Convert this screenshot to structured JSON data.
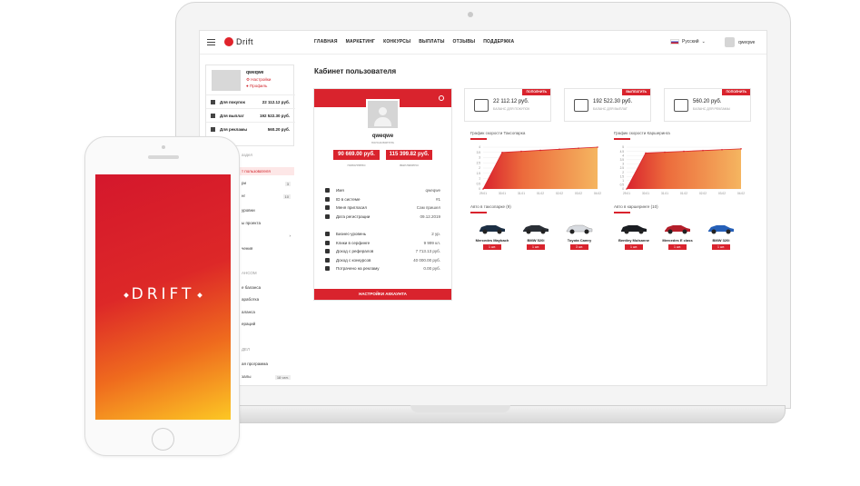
{
  "topbar": {
    "logo": "Drift",
    "nav": [
      "ГЛАВНАЯ",
      "МАРКЕТИНГ",
      "КОНКУРСЫ",
      "ВЫПЛАТЫ",
      "ОТЗЫВЫ",
      "ПОДДЕРЖКА"
    ],
    "language": "Русский",
    "username": "qweqwe"
  },
  "sidebar": {
    "name": "qweqwe",
    "link_settings": "Настройки",
    "link_profile": "Профиль",
    "rows": [
      {
        "label": "Для покупок",
        "value": "22 112.12 руб."
      },
      {
        "label": "Для выплат",
        "value": "192 522.30 руб."
      },
      {
        "label": "Для рекламы",
        "value": "560.20 руб."
      }
    ],
    "menu": [
      {
        "text": "аздел",
        "type": "head"
      },
      {
        "text": "т пользователя",
        "type": "active"
      },
      {
        "text": "ри",
        "count": "3"
      },
      {
        "text": "нг",
        "count": "10"
      },
      {
        "text": "уровни"
      },
      {
        "text": "ы проекта"
      },
      {
        "text": ""
      },
      {
        "text": "чения"
      },
      {
        "text": "АНСОМ",
        "type": "head"
      },
      {
        "text": "е баланса"
      },
      {
        "text": "аработка"
      },
      {
        "text": "аланса"
      },
      {
        "text": "ераций"
      },
      {
        "text": "ДЕЛ",
        "type": "head"
      },
      {
        "text": "ая программа"
      },
      {
        "text": "залы",
        "count": "18 чел."
      }
    ]
  },
  "main": {
    "page_title": "Кабинет пользователя",
    "profile": {
      "name": "qweqwe",
      "role": "пользователь",
      "deposit": "90 669.00 руб.",
      "deposit_label": "пополнено",
      "withdrawn": "115 399.82 руб.",
      "withdrawn_label": "выплачено",
      "info": [
        {
          "k": "Имя",
          "v": "qweqwe"
        },
        {
          "k": "ID в системе",
          "v": "#1"
        },
        {
          "k": "Меня пригласил",
          "v": "Сам пришел"
        },
        {
          "k": "Дата регистрации",
          "v": "09.12.2019"
        }
      ],
      "stats": [
        {
          "k": "Бизнес-уровень",
          "v": "2 ур."
        },
        {
          "k": "Клики в серфинге",
          "v": "9 999 кл."
        },
        {
          "k": "Доход с рефералов",
          "v": "7 713.13 руб."
        },
        {
          "k": "Доход с конкурсов",
          "v": "40 000.00 руб."
        },
        {
          "k": "Потрачено на рекламу",
          "v": "0.00 руб."
        }
      ],
      "settings_button": "НАСТРОЙКИ АККАУНТА"
    },
    "balances": [
      {
        "amount": "22 112.12 руб.",
        "sub": "БАЛАНС ДЛЯ ПОКУПОК",
        "button": "ПОПОЛНИТЬ"
      },
      {
        "amount": "192 522.30 руб.",
        "sub": "БАЛАНС ДЛЯ ВЫПЛАТ",
        "button": "ВЫПЛАТИТЬ"
      },
      {
        "amount": "560.20 руб.",
        "sub": "БАЛАНС ДЛЯ РЕКЛАМЫ",
        "button": "ПОПОЛНИТЬ"
      }
    ],
    "cars_taxi_title": "Авто в таксопарке (9)",
    "cars_taxi": [
      {
        "name": "Mercedes Maybach",
        "count": "1 шт."
      },
      {
        "name": "BMW 520i",
        "count": "1 шт."
      },
      {
        "name": "Toyota Camry",
        "count": "3 шт."
      }
    ],
    "cars_share_title": "Авто в каршеринге (10)",
    "cars_share": [
      {
        "name": "Bentley Mulsanne",
        "count": "1 шт."
      },
      {
        "name": "Mercedes E class",
        "count": "1 шт."
      },
      {
        "name": "BMW 320i",
        "count": "1 шт."
      }
    ]
  },
  "chart_data": [
    {
      "type": "area",
      "title": "График скорости Таксопарка",
      "x": [
        "29.01",
        "30.01",
        "31.01",
        "01.02",
        "02.02",
        "03.02",
        "04.02"
      ],
      "values": [
        0,
        3.5,
        3.6,
        3.7,
        3.8,
        3.9,
        4.0
      ],
      "yticks": [
        "0",
        "0.5",
        "1",
        "1.5",
        "2",
        "2.5",
        "3",
        "3.5",
        "4"
      ],
      "ylim": [
        0,
        4
      ],
      "color": "#d9232d"
    },
    {
      "type": "area",
      "title": "График скорости Каршеринга",
      "x": [
        "29.01",
        "30.01",
        "31.01",
        "01.02",
        "02.02",
        "03.02",
        "04.02"
      ],
      "values": [
        0,
        4.3,
        4.4,
        4.5,
        4.6,
        4.7,
        4.8
      ],
      "yticks": [
        "0",
        "0.5",
        "1",
        "1.5",
        "2",
        "2.5",
        "3",
        "3.5",
        "4",
        "4.5",
        "5"
      ],
      "ylim": [
        0,
        5
      ],
      "color": "#d9232d"
    }
  ],
  "phone": {
    "logo": "DRIFT"
  }
}
